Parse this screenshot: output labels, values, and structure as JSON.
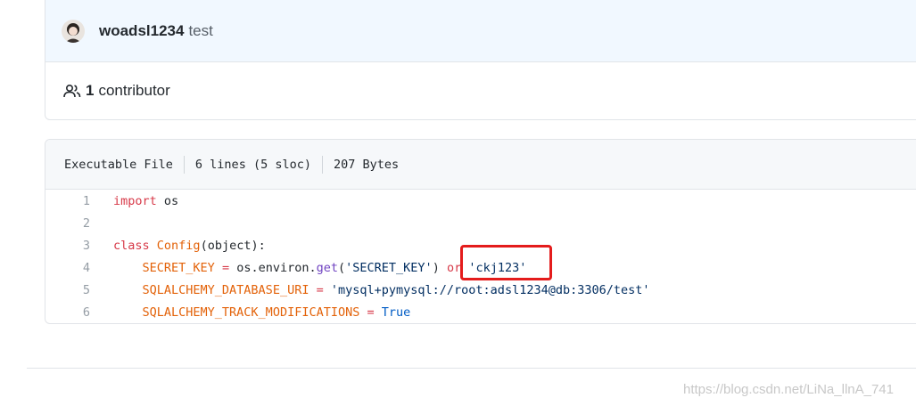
{
  "commit": {
    "author": "woadsl1234",
    "message": "test",
    "contributors_count": "1",
    "contributors_label": "contributor",
    "avatar_icon": "user-avatar",
    "people_icon": "people-icon"
  },
  "file": {
    "type": "Executable File",
    "lines": "6 lines (5 sloc)",
    "size": "207 Bytes",
    "code_lines": [
      {
        "num": "1",
        "tokens": [
          {
            "t": "import",
            "c": "kw"
          },
          {
            "t": " os",
            "c": ""
          }
        ]
      },
      {
        "num": "2",
        "tokens": []
      },
      {
        "num": "3",
        "tokens": [
          {
            "t": "class",
            "c": "kw"
          },
          {
            "t": " ",
            "c": ""
          },
          {
            "t": "Config",
            "c": "cls"
          },
          {
            "t": "(object):",
            "c": ""
          }
        ]
      },
      {
        "num": "4",
        "tokens": [
          {
            "t": "    ",
            "c": ""
          },
          {
            "t": "SECRET_KEY",
            "c": "var"
          },
          {
            "t": " ",
            "c": ""
          },
          {
            "t": "=",
            "c": "op"
          },
          {
            "t": " os.environ.",
            "c": ""
          },
          {
            "t": "get",
            "c": "fn"
          },
          {
            "t": "(",
            "c": ""
          },
          {
            "t": "'SECRET_KEY'",
            "c": "str"
          },
          {
            "t": ") ",
            "c": ""
          },
          {
            "t": "or",
            "c": "kw"
          },
          {
            "t": " ",
            "c": ""
          },
          {
            "t": "'ckj123'",
            "c": "str"
          }
        ]
      },
      {
        "num": "5",
        "tokens": [
          {
            "t": "    ",
            "c": ""
          },
          {
            "t": "SQLALCHEMY_DATABASE_URI",
            "c": "var"
          },
          {
            "t": " ",
            "c": ""
          },
          {
            "t": "=",
            "c": "op"
          },
          {
            "t": " ",
            "c": ""
          },
          {
            "t": "'mysql+pymysql://root:adsl1234@db:3306/test'",
            "c": "str"
          }
        ]
      },
      {
        "num": "6",
        "tokens": [
          {
            "t": "    ",
            "c": ""
          },
          {
            "t": "SQLALCHEMY_TRACK_MODIFICATIONS",
            "c": "var"
          },
          {
            "t": " ",
            "c": ""
          },
          {
            "t": "=",
            "c": "op"
          },
          {
            "t": " ",
            "c": ""
          },
          {
            "t": "True",
            "c": "cst"
          }
        ]
      }
    ]
  },
  "annotation": {
    "highlight_color": "#e41c1c"
  },
  "watermark": "https://blog.csdn.net/LiNa_llnA_741"
}
